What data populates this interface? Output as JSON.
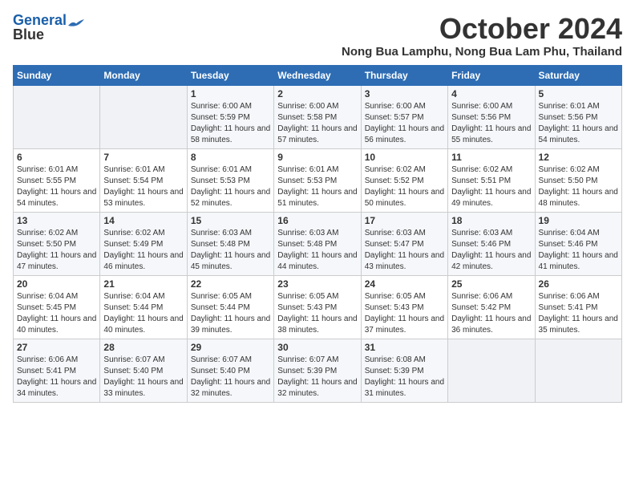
{
  "header": {
    "logo_line1": "General",
    "logo_line2": "Blue",
    "month_title": "October 2024",
    "subtitle": "Nong Bua Lamphu, Nong Bua Lam Phu, Thailand"
  },
  "weekdays": [
    "Sunday",
    "Monday",
    "Tuesday",
    "Wednesday",
    "Thursday",
    "Friday",
    "Saturday"
  ],
  "weeks": [
    [
      {
        "day": "",
        "info": ""
      },
      {
        "day": "",
        "info": ""
      },
      {
        "day": "1",
        "info": "Sunrise: 6:00 AM\nSunset: 5:59 PM\nDaylight: 11 hours and 58 minutes."
      },
      {
        "day": "2",
        "info": "Sunrise: 6:00 AM\nSunset: 5:58 PM\nDaylight: 11 hours and 57 minutes."
      },
      {
        "day": "3",
        "info": "Sunrise: 6:00 AM\nSunset: 5:57 PM\nDaylight: 11 hours and 56 minutes."
      },
      {
        "day": "4",
        "info": "Sunrise: 6:00 AM\nSunset: 5:56 PM\nDaylight: 11 hours and 55 minutes."
      },
      {
        "day": "5",
        "info": "Sunrise: 6:01 AM\nSunset: 5:56 PM\nDaylight: 11 hours and 54 minutes."
      }
    ],
    [
      {
        "day": "6",
        "info": "Sunrise: 6:01 AM\nSunset: 5:55 PM\nDaylight: 11 hours and 54 minutes."
      },
      {
        "day": "7",
        "info": "Sunrise: 6:01 AM\nSunset: 5:54 PM\nDaylight: 11 hours and 53 minutes."
      },
      {
        "day": "8",
        "info": "Sunrise: 6:01 AM\nSunset: 5:53 PM\nDaylight: 11 hours and 52 minutes."
      },
      {
        "day": "9",
        "info": "Sunrise: 6:01 AM\nSunset: 5:53 PM\nDaylight: 11 hours and 51 minutes."
      },
      {
        "day": "10",
        "info": "Sunrise: 6:02 AM\nSunset: 5:52 PM\nDaylight: 11 hours and 50 minutes."
      },
      {
        "day": "11",
        "info": "Sunrise: 6:02 AM\nSunset: 5:51 PM\nDaylight: 11 hours and 49 minutes."
      },
      {
        "day": "12",
        "info": "Sunrise: 6:02 AM\nSunset: 5:50 PM\nDaylight: 11 hours and 48 minutes."
      }
    ],
    [
      {
        "day": "13",
        "info": "Sunrise: 6:02 AM\nSunset: 5:50 PM\nDaylight: 11 hours and 47 minutes."
      },
      {
        "day": "14",
        "info": "Sunrise: 6:02 AM\nSunset: 5:49 PM\nDaylight: 11 hours and 46 minutes."
      },
      {
        "day": "15",
        "info": "Sunrise: 6:03 AM\nSunset: 5:48 PM\nDaylight: 11 hours and 45 minutes."
      },
      {
        "day": "16",
        "info": "Sunrise: 6:03 AM\nSunset: 5:48 PM\nDaylight: 11 hours and 44 minutes."
      },
      {
        "day": "17",
        "info": "Sunrise: 6:03 AM\nSunset: 5:47 PM\nDaylight: 11 hours and 43 minutes."
      },
      {
        "day": "18",
        "info": "Sunrise: 6:03 AM\nSunset: 5:46 PM\nDaylight: 11 hours and 42 minutes."
      },
      {
        "day": "19",
        "info": "Sunrise: 6:04 AM\nSunset: 5:46 PM\nDaylight: 11 hours and 41 minutes."
      }
    ],
    [
      {
        "day": "20",
        "info": "Sunrise: 6:04 AM\nSunset: 5:45 PM\nDaylight: 11 hours and 40 minutes."
      },
      {
        "day": "21",
        "info": "Sunrise: 6:04 AM\nSunset: 5:44 PM\nDaylight: 11 hours and 40 minutes."
      },
      {
        "day": "22",
        "info": "Sunrise: 6:05 AM\nSunset: 5:44 PM\nDaylight: 11 hours and 39 minutes."
      },
      {
        "day": "23",
        "info": "Sunrise: 6:05 AM\nSunset: 5:43 PM\nDaylight: 11 hours and 38 minutes."
      },
      {
        "day": "24",
        "info": "Sunrise: 6:05 AM\nSunset: 5:43 PM\nDaylight: 11 hours and 37 minutes."
      },
      {
        "day": "25",
        "info": "Sunrise: 6:06 AM\nSunset: 5:42 PM\nDaylight: 11 hours and 36 minutes."
      },
      {
        "day": "26",
        "info": "Sunrise: 6:06 AM\nSunset: 5:41 PM\nDaylight: 11 hours and 35 minutes."
      }
    ],
    [
      {
        "day": "27",
        "info": "Sunrise: 6:06 AM\nSunset: 5:41 PM\nDaylight: 11 hours and 34 minutes."
      },
      {
        "day": "28",
        "info": "Sunrise: 6:07 AM\nSunset: 5:40 PM\nDaylight: 11 hours and 33 minutes."
      },
      {
        "day": "29",
        "info": "Sunrise: 6:07 AM\nSunset: 5:40 PM\nDaylight: 11 hours and 32 minutes."
      },
      {
        "day": "30",
        "info": "Sunrise: 6:07 AM\nSunset: 5:39 PM\nDaylight: 11 hours and 32 minutes."
      },
      {
        "day": "31",
        "info": "Sunrise: 6:08 AM\nSunset: 5:39 PM\nDaylight: 11 hours and 31 minutes."
      },
      {
        "day": "",
        "info": ""
      },
      {
        "day": "",
        "info": ""
      }
    ]
  ]
}
